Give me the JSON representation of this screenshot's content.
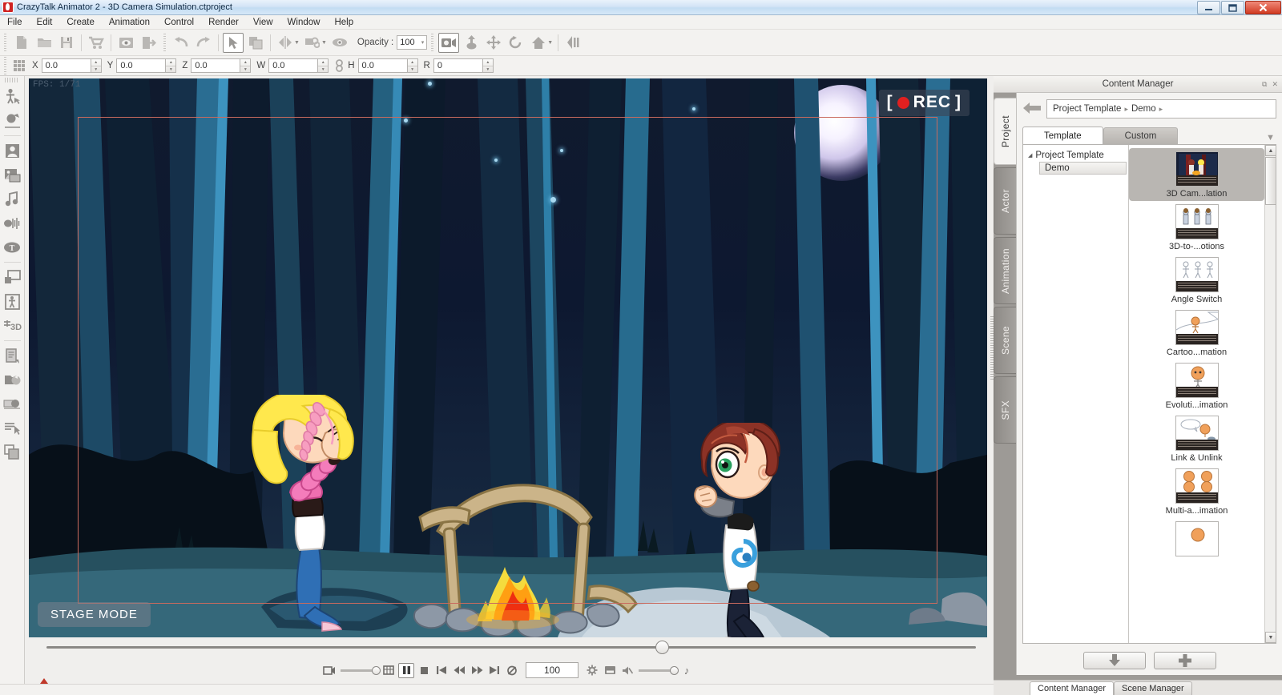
{
  "window": {
    "title": "CrazyTalk Animator 2  - 3D Camera Simulation.ctproject",
    "minimize": "—",
    "maximize": "❐",
    "close": "✕"
  },
  "menu": [
    "File",
    "Edit",
    "Create",
    "Animation",
    "Control",
    "Render",
    "View",
    "Window",
    "Help"
  ],
  "toolbar": {
    "buttons": [
      {
        "name": "new-project-icon",
        "title": "New"
      },
      {
        "name": "open-project-icon",
        "title": "Open"
      },
      {
        "name": "save-project-icon",
        "title": "Save"
      },
      {
        "name": "shopping-cart-icon",
        "title": "Marketplace"
      },
      {
        "name": "preview-icon",
        "title": "Preview"
      },
      {
        "name": "export-icon",
        "title": "Export"
      },
      {
        "name": "undo-icon",
        "title": "Undo"
      },
      {
        "name": "redo-icon",
        "title": "Redo"
      },
      {
        "name": "select-arrow-icon",
        "title": "Select"
      },
      {
        "name": "duplicate-icon",
        "title": "Duplicate"
      },
      {
        "name": "mirror-icon",
        "title": "Mirror"
      },
      {
        "name": "link-icon",
        "title": "Link"
      },
      {
        "name": "eye-icon",
        "title": "Visibility"
      }
    ],
    "opacity_label": "Opacity :",
    "opacity_value": "100",
    "camera_buttons": [
      {
        "name": "camera-icon",
        "title": "Camera"
      },
      {
        "name": "pan-vertical-icon",
        "title": "Dolly"
      },
      {
        "name": "move-icon",
        "title": "Move"
      },
      {
        "name": "rotate-icon",
        "title": "Rotate"
      },
      {
        "name": "home-icon",
        "title": "Home View"
      },
      {
        "name": "layers-icon",
        "title": "Layers"
      }
    ]
  },
  "transform_bar": {
    "grid_icon": "grid-icon",
    "fields": [
      {
        "label": "X",
        "value": "0.0"
      },
      {
        "label": "Y",
        "value": "0.0"
      },
      {
        "label": "Z",
        "value": "0.0"
      },
      {
        "label": "W",
        "value": "0.0"
      },
      {
        "label": "H",
        "value": "0.0"
      },
      {
        "label": "R",
        "value": "0"
      }
    ],
    "chain_icon": "link-aspect-icon"
  },
  "left_rail": [
    {
      "name": "actor-tool-icon",
      "title": "Actor"
    },
    {
      "name": "prop-tool-icon",
      "title": "Prop"
    },
    {
      "name": "face-tool-icon",
      "title": "Face"
    },
    {
      "name": "scene-tool-icon",
      "title": "Scene"
    },
    {
      "name": "audio-tool-icon",
      "title": "Audio"
    },
    {
      "name": "waveform-tool-icon",
      "title": "Waveform"
    },
    {
      "name": "text-tool-icon",
      "title": "Text"
    },
    {
      "name": "layer-tool-icon",
      "title": "Layer"
    },
    {
      "name": "bone-tool-icon",
      "title": "Bone Editor"
    },
    {
      "name": "3d-tool-icon",
      "title": "3D"
    },
    {
      "name": "script-tool-icon",
      "title": "Script"
    },
    {
      "name": "folder-tool-icon",
      "title": "Library"
    },
    {
      "name": "record-tool-icon",
      "title": "Record"
    },
    {
      "name": "timeline-tool-icon",
      "title": "Timeline"
    },
    {
      "name": "composite-tool-icon",
      "title": "Composite"
    }
  ],
  "viewport": {
    "fps_text": "FPS: 1/71",
    "rec_badge": "REC",
    "rec_bracket_left": "[",
    "rec_bracket_right": "]",
    "stage_mode": "STAGE MODE",
    "colors": {
      "sky": "#101a2e",
      "tree_dark": "#0f2030",
      "tree_blue": "#2e7fa8",
      "ground": "#2b5668",
      "safe_frame": "#c96a5e",
      "rec_red": "#e02020",
      "fire_orange": "#f59c14",
      "fire_red": "#e02b10",
      "hair_blonde": "#ffe84d",
      "hair_red": "#8c3226",
      "sleeve_pink": "#ef6fb0",
      "jeans_blue": "#2f6fb5"
    }
  },
  "timeline": {
    "slider_value": 66
  },
  "transport": {
    "left_slider_name": "camera-zoom-slider",
    "buttons": [
      {
        "name": "film-icon",
        "glyph": "film"
      },
      {
        "name": "frame-view-icon",
        "glyph": "frame"
      },
      {
        "name": "pause-button",
        "glyph": "pause",
        "active": true
      },
      {
        "name": "stop-button",
        "glyph": "stop"
      },
      {
        "name": "jump-start-button",
        "glyph": "jump-start"
      },
      {
        "name": "rewind-button",
        "glyph": "rewind"
      },
      {
        "name": "forward-button",
        "glyph": "forward"
      },
      {
        "name": "jump-end-button",
        "glyph": "jump-end"
      },
      {
        "name": "loop-button",
        "glyph": "loop"
      }
    ],
    "frame_value": "100",
    "right_buttons": [
      {
        "name": "gear-icon",
        "glyph": "gear"
      },
      {
        "name": "render-icon",
        "glyph": "render"
      },
      {
        "name": "mute-icon",
        "glyph": "mute"
      }
    ],
    "music_note": "♪"
  },
  "content_manager": {
    "title": "Content Manager",
    "header_icons": [
      {
        "name": "float-panel-icon",
        "glyph": "⧉"
      },
      {
        "name": "close-panel-icon",
        "glyph": "✕"
      }
    ],
    "back_arrow": "back-arrow-icon",
    "breadcrumb": [
      {
        "label": "Project Template",
        "sep": "▸"
      },
      {
        "label": "Demo",
        "sep": "▸"
      }
    ],
    "vertical_tabs": [
      {
        "label": "Project",
        "active": true
      },
      {
        "label": "Actor",
        "active": false
      },
      {
        "label": "Animation",
        "active": false
      },
      {
        "label": "Scene",
        "active": false
      },
      {
        "label": "SFX",
        "active": false
      }
    ],
    "horizontal_tabs": [
      {
        "label": "Template",
        "active": true
      },
      {
        "label": "Custom",
        "active": false
      }
    ],
    "tabs_caret": "▼",
    "tree": {
      "root": "Project Template",
      "root_arrow": "◢",
      "children": [
        "Demo"
      ]
    },
    "thumbnails": [
      {
        "label": "3D Cam...lation",
        "selected": true,
        "kind": "scene-night"
      },
      {
        "label": "3D-to-...otions",
        "selected": false,
        "kind": "walk-three"
      },
      {
        "label": "Angle Switch",
        "selected": false,
        "kind": "stick-three"
      },
      {
        "label": "Cartoo...mation",
        "selected": false,
        "kind": "hill-run"
      },
      {
        "label": "Evoluti...imation",
        "selected": false,
        "kind": "single-boy"
      },
      {
        "label": "Link & Unlink",
        "selected": false,
        "kind": "speech-bubble"
      },
      {
        "label": "Multi-a...imation",
        "selected": false,
        "kind": "four-faces"
      }
    ],
    "buttons": [
      {
        "name": "download-content-button",
        "glyph": "⬇"
      },
      {
        "name": "add-content-button",
        "glyph": "✚"
      }
    ],
    "bottom_tabs": [
      {
        "label": "Content Manager",
        "active": true
      },
      {
        "label": "Scene Manager",
        "active": false
      }
    ]
  }
}
